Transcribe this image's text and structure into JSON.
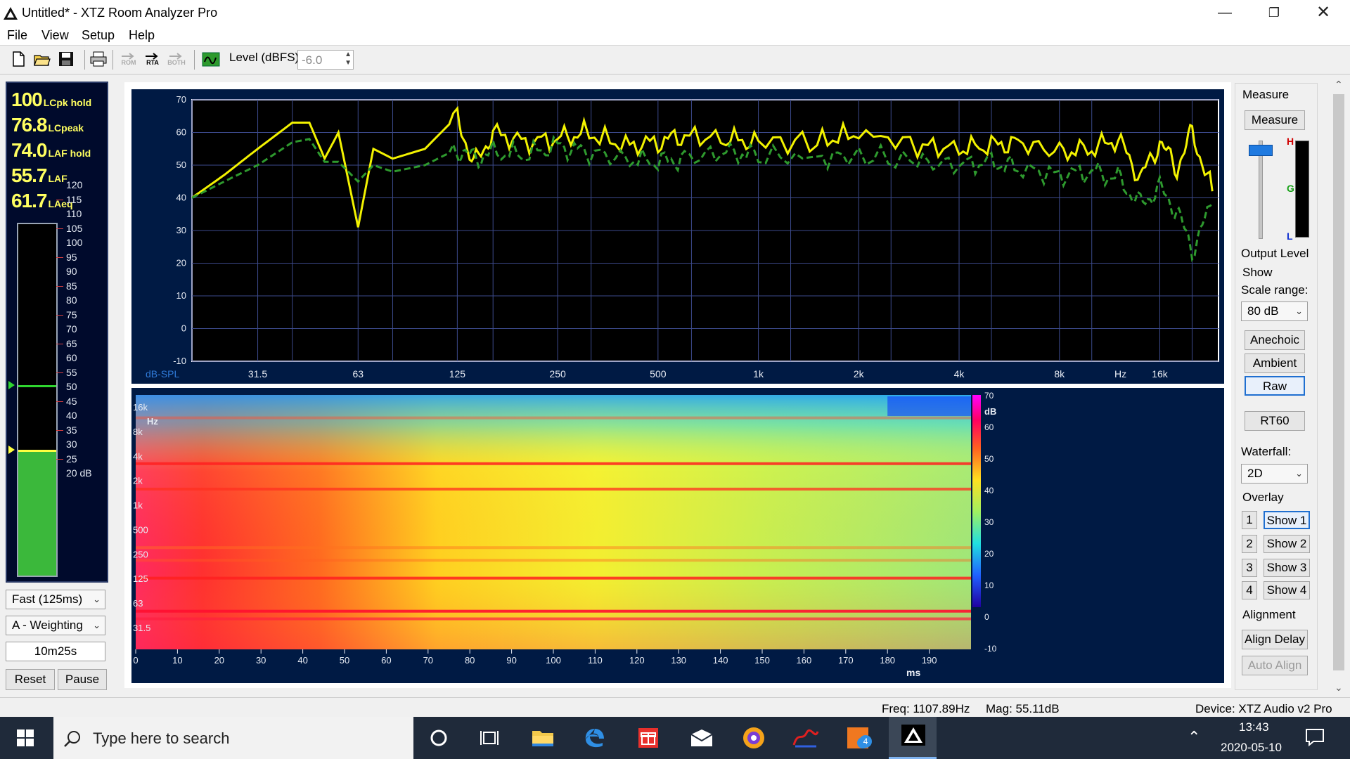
{
  "window": {
    "title": "Untitled* - XTZ Room Analyzer Pro"
  },
  "menu": [
    "File",
    "View",
    "Setup",
    "Help"
  ],
  "toolbar": {
    "level_label": "Level (dBFS)",
    "level_value": "-6.0",
    "rom_label": "ROM",
    "rta_label": "RTA",
    "both_label": "BOTH"
  },
  "meter": {
    "readouts": [
      {
        "value": "100",
        "label": "LCpk hold"
      },
      {
        "value": "76.8",
        "label": "LCpeak"
      },
      {
        "value": "74.0",
        "label": "LAF hold"
      },
      {
        "value": "55.7",
        "label": "LAF"
      },
      {
        "value": "61.7",
        "label": "LAeq"
      }
    ],
    "scale": [
      "120",
      "115",
      "110",
      "105",
      "100",
      "95",
      "90",
      "85",
      "80",
      "75",
      "70",
      "65",
      "60",
      "55",
      "50",
      "45",
      "40",
      "35",
      "30",
      "25",
      "20 dB"
    ],
    "level_db": 55.7,
    "hold_db": 74.0,
    "response": "Fast (125ms)",
    "weighting": "A - Weighting",
    "elapsed": "10m25s",
    "reset_label": "Reset",
    "pause_label": "Pause"
  },
  "freq_chart": {
    "y_unit": "dB-SPL",
    "x_unit": "Hz"
  },
  "spec_chart": {
    "x_unit": "ms",
    "y_unit": "Hz",
    "colorbar_unit": "dB"
  },
  "chart_data": [
    {
      "type": "line",
      "title": "",
      "xlabel": "Hz",
      "ylabel": "dB-SPL",
      "xscale": "log",
      "xlim": [
        20,
        24000
      ],
      "ylim": [
        -10,
        70
      ],
      "x_ticks": [
        "31.5",
        "63",
        "125",
        "250",
        "500",
        "1k",
        "2k",
        "4k",
        "8k",
        "16k"
      ],
      "y_ticks": [
        "70",
        "60",
        "50",
        "40",
        "30",
        "20",
        "10",
        "0",
        "-10"
      ],
      "grid": true,
      "series": [
        {
          "color": "#f2f200",
          "style": "solid",
          "x": [
            20,
            25,
            31.5,
            40,
            45,
            50,
            55,
            63,
            70,
            80,
            100,
            125,
            140,
            160,
            200,
            250,
            300,
            400,
            500,
            600,
            800,
            1000,
            1500,
            2000,
            3000,
            4000,
            5000,
            6000,
            8000,
            10000,
            12000,
            14000,
            16000,
            18000,
            20000,
            23000
          ],
          "y": [
            40,
            47,
            55,
            63,
            63,
            52,
            60,
            31,
            55,
            52,
            55,
            65,
            50,
            60,
            57,
            58,
            60,
            56,
            57,
            59,
            58,
            57,
            57,
            60,
            56,
            55,
            56,
            57,
            54,
            55,
            58,
            46,
            57,
            49,
            60,
            42
          ]
        },
        {
          "color": "#2e9a2e",
          "style": "dashed",
          "x": [
            20,
            25,
            31.5,
            40,
            45,
            50,
            55,
            63,
            70,
            80,
            100,
            125,
            140,
            160,
            200,
            250,
            300,
            400,
            500,
            600,
            800,
            1000,
            1500,
            2000,
            3000,
            4000,
            5000,
            6000,
            8000,
            10000,
            12000,
            14000,
            16000,
            18000,
            20000,
            23000
          ],
          "y": [
            40,
            45,
            50,
            57,
            58,
            51,
            51,
            45,
            50,
            48,
            50,
            55,
            52,
            54,
            53,
            56,
            54,
            52,
            51,
            52,
            54,
            53,
            52,
            53,
            51,
            50,
            51,
            49,
            47,
            48,
            46,
            38,
            43,
            36,
            24,
            38
          ]
        }
      ]
    },
    {
      "type": "heatmap",
      "title": "",
      "xlabel": "ms",
      "ylabel": "Hz",
      "xlim": [
        0,
        200
      ],
      "x_ticks": [
        "0",
        "10",
        "20",
        "30",
        "40",
        "50",
        "60",
        "70",
        "80",
        "90",
        "100",
        "110",
        "120",
        "130",
        "140",
        "150",
        "160",
        "170",
        "180",
        "190"
      ],
      "y_ticks": [
        "16k",
        "8k",
        "4k",
        "2k",
        "1k",
        "500",
        "250",
        "125",
        "63",
        "31.5"
      ],
      "colorbar_range": [
        -10,
        70
      ],
      "colorbar_ticks": [
        "70",
        "60",
        "50",
        "40",
        "30",
        "20",
        "10",
        "0",
        "-10"
      ]
    }
  ],
  "right_panel": {
    "measure_header": "Measure",
    "measure_button": "Measure",
    "level_marks": [
      "H",
      "G",
      "L"
    ],
    "output_level_label": "Output Level",
    "show_header": "Show",
    "scale_range_label": "Scale range:",
    "scale_range_value": "80 dB",
    "anechoic": "Anechoic",
    "ambient": "Ambient",
    "raw": "Raw",
    "rt60": "RT60",
    "waterfall_label": "Waterfall:",
    "waterfall_value": "2D",
    "overlay_header": "Overlay",
    "overlays": [
      {
        "num": "1",
        "label": "Show 1"
      },
      {
        "num": "2",
        "label": "Show 2"
      },
      {
        "num": "3",
        "label": "Show 3"
      },
      {
        "num": "4",
        "label": "Show 4"
      }
    ],
    "alignment_header": "Alignment",
    "align_delay": "Align Delay",
    "auto_align": "Auto Align"
  },
  "status": {
    "freq": "Freq: 1107.89Hz",
    "mag": "Mag: 55.11dB",
    "device": "Device: XTZ Audio v2 Pro"
  },
  "taskbar": {
    "search_placeholder": "Type here to search",
    "time": "13:43",
    "date": "2020-05-10",
    "badge": "4"
  },
  "colors": {
    "meter_bg": "#000a2c",
    "meter_text": "#ffff60",
    "meter_bar": "#3bb83b",
    "chart_bg": "#000000",
    "chart_frame": "#001a44",
    "taskbar_bg": "#1f2a3a"
  }
}
